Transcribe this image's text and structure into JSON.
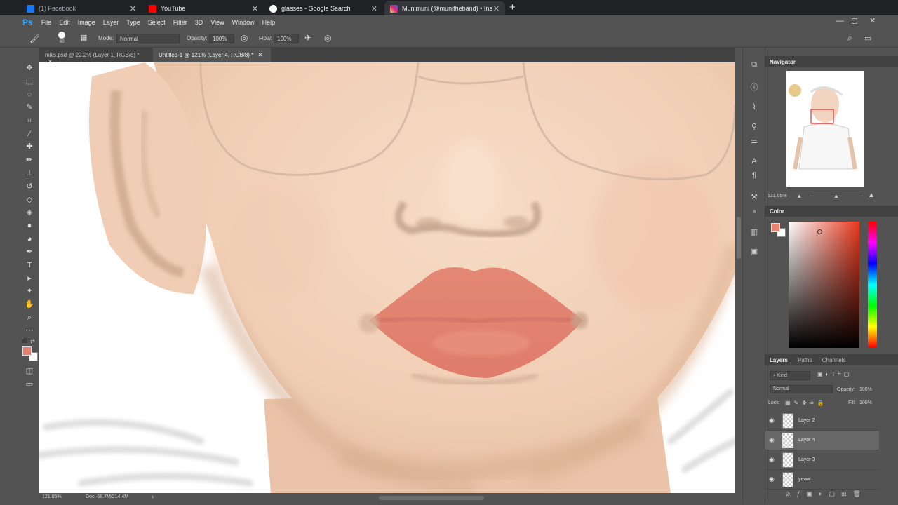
{
  "browser": {
    "tabs": [
      {
        "title": "(1) Facebook",
        "icon": "facebook-icon",
        "color": "#1877f2"
      },
      {
        "title": "YouTube",
        "icon": "youtube-icon",
        "color": "#ff0000"
      },
      {
        "title": "glasses - Google Search",
        "icon": "google-icon",
        "color": "#ffffff"
      },
      {
        "title": "Munimuni (@munitheband) • Ins",
        "icon": "instagram-icon",
        "color": "#e1306c"
      }
    ],
    "new_tab": "+"
  },
  "photoshop": {
    "logo": "Ps",
    "menu": [
      "File",
      "Edit",
      "Image",
      "Layer",
      "Type",
      "Select",
      "Filter",
      "3D",
      "View",
      "Window",
      "Help"
    ],
    "options": {
      "brush_size": "60",
      "mode_label": "Mode:",
      "mode_value": "Normal",
      "opacity_label": "Opacity:",
      "opacity_value": "100%",
      "flow_label": "Flow:",
      "flow_value": "100%"
    },
    "doc_tabs": [
      {
        "title": "miiis.psd @ 22.2% (Layer 1, RGB/8) *",
        "active": false
      },
      {
        "title": "Untitled-1 @ 121% (Layer 4, RGB/8) *",
        "active": true
      }
    ],
    "status": {
      "zoom": "121.05%",
      "doc": "Doc: 68.7M/214.4M"
    },
    "navigator": {
      "title": "Navigator",
      "zoom": "121.05%"
    },
    "color_panel": {
      "title": "Color",
      "foreground": "#e8826e",
      "background": "#ffffff"
    },
    "layers_panel": {
      "tabs": [
        "Layers",
        "Paths",
        "Channels"
      ],
      "kind": "Kind",
      "blend": "Normal",
      "opacity_label": "Opacity:",
      "opacity_value": "100%",
      "lock_label": "Lock:",
      "fill_label": "Fill:",
      "fill_value": "100%",
      "layers": [
        {
          "name": "Layer 2",
          "selected": false
        },
        {
          "name": "Layer 4",
          "selected": true
        },
        {
          "name": "Layer 3",
          "selected": false
        },
        {
          "name": "yeww",
          "selected": false
        }
      ]
    }
  }
}
